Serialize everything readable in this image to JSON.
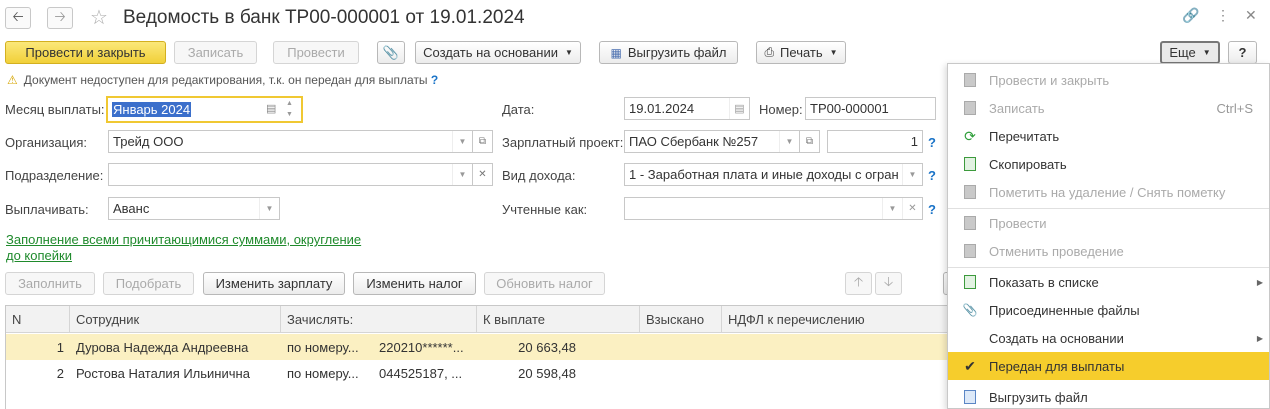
{
  "window": {
    "title": "Ведомость в банк ТР00-000001 от 19.01.2024"
  },
  "toolbar": {
    "post_close": "Провести и закрыть",
    "write": "Записать",
    "post": "Провести",
    "create_based_on": "Создать на основании",
    "export_file": "Выгрузить файл",
    "print": "Печать",
    "more": "Еще",
    "help": "?"
  },
  "warning": {
    "text": "Документ недоступен для редактирования, т.к. он передан для выплаты",
    "help": "?"
  },
  "form": {
    "month_label": "Месяц выплаты:",
    "month_value": "Январь 2024",
    "org_label": "Организация:",
    "org_value": "Трейд ООО",
    "dept_label": "Подразделение:",
    "dept_value": "",
    "pay_label": "Выплачивать:",
    "pay_value": "Аванс",
    "date_label": "Дата:",
    "date_value": "19.01.2024",
    "number_label": "Номер:",
    "number_value": "ТР00-000001",
    "salary_project_label": "Зарплатный проект:",
    "salary_project_value": "ПАО Сбербанк №257",
    "salary_project_count": "1",
    "income_label": "Вид дохода:",
    "income_value": "1 - Заработная плата и иные доходы с ограни",
    "accounted_label": "Учтенные как:",
    "accounted_value": "",
    "help": "?"
  },
  "fill_link": {
    "line1": "Заполнение всеми причитающимися суммами, округление",
    "line2": "до копейки"
  },
  "table_toolbar": {
    "fill": "Заполнить",
    "pick": "Подобрать",
    "change_salary": "Изменить зарплату",
    "change_tax": "Изменить налог",
    "update_tax": "Обновить налог"
  },
  "table": {
    "headers": [
      "N",
      "Сотрудник",
      "Зачислять:",
      "К выплате",
      "Взыскано",
      "НДФЛ к перечислению"
    ],
    "rows": [
      {
        "n": "1",
        "employee": "Дурова Надежда Андреевна",
        "method": "по номеру...",
        "account": "220210******...",
        "amount": "20 663,48"
      },
      {
        "n": "2",
        "employee": "Ростова Наталия Ильинична",
        "method": "по номеру...",
        "account": "044525187, ...",
        "amount": "20 598,48"
      }
    ]
  },
  "menu": {
    "items": [
      {
        "label": "Провести и закрыть",
        "shortcut": ""
      },
      {
        "label": "Записать",
        "shortcut": "Ctrl+S"
      },
      {
        "label": "Перечитать",
        "shortcut": ""
      },
      {
        "label": "Скопировать",
        "shortcut": ""
      },
      {
        "label": "Пометить на удаление / Снять пометку",
        "shortcut": ""
      },
      {
        "label": "Провести",
        "shortcut": ""
      },
      {
        "label": "Отменить проведение",
        "shortcut": ""
      },
      {
        "label": "Показать в списке",
        "shortcut": ""
      },
      {
        "label": "Присоединенные файлы",
        "shortcut": ""
      },
      {
        "label": "Создать на основании",
        "shortcut": ""
      },
      {
        "label": "Передан для выплаты",
        "shortcut": ""
      },
      {
        "label": "Выгрузить файл",
        "shortcut": ""
      }
    ]
  },
  "colors": {
    "accent": "#f1d039",
    "highlight": "#f6cd2c",
    "link": "#1f8a2c",
    "selected_row": "#fbf0c2"
  }
}
